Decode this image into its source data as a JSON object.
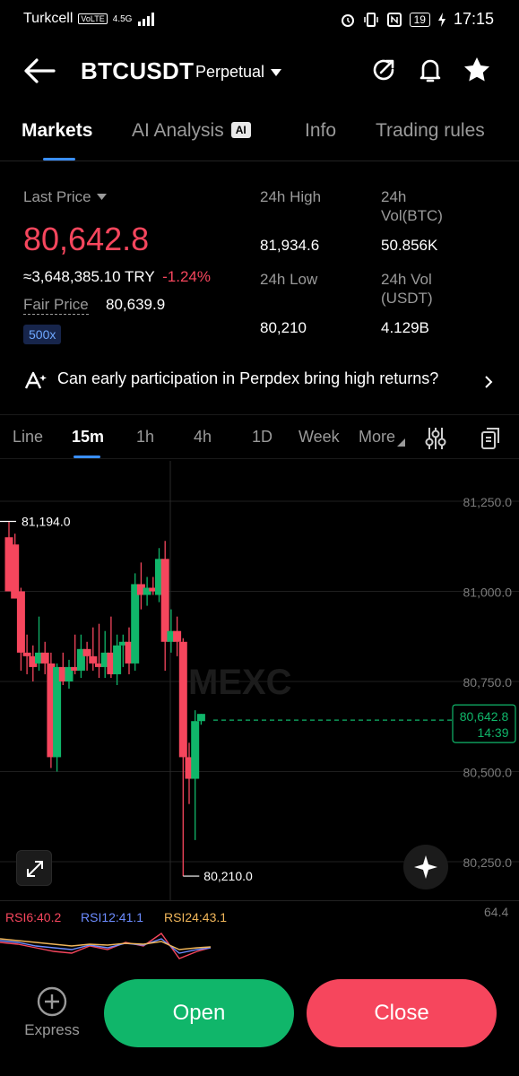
{
  "status_bar": {
    "carrier": "Turkcell",
    "volte": "VoLTE",
    "signal": "4.5G",
    "battery": "19",
    "time": "17:15"
  },
  "header": {
    "symbol": "BTCUSDT",
    "contract": "Perpetual"
  },
  "tabs": [
    {
      "label": "Markets",
      "active": true
    },
    {
      "label": "AI Analysis",
      "badge": "AI"
    },
    {
      "label": "Info"
    },
    {
      "label": "Trading rules"
    }
  ],
  "stats": {
    "last_price_label": "Last Price",
    "last_price": "80,642.8",
    "try_value": "≈3,648,385.10 TRY",
    "change": "-1.24%",
    "fair_price_label": "Fair Price",
    "fair_price": "80,639.9",
    "leverage": "500x",
    "high_label": "24h High",
    "high": "81,934.6",
    "low_label": "24h Low",
    "low": "80,210",
    "vol_btc_label_1": "24h",
    "vol_btc_label_2": "Vol(BTC)",
    "vol_btc": "50.856K",
    "vol_usdt_label_1": "24h Vol",
    "vol_usdt_label_2": "(USDT)",
    "vol_usdt": "4.129B"
  },
  "banner": {
    "text": "Can early participation in Perpdex bring high returns?"
  },
  "intervals": [
    {
      "label": "Line"
    },
    {
      "label": "15m",
      "active": true
    },
    {
      "label": "1h"
    },
    {
      "label": "4h"
    },
    {
      "label": "1D"
    },
    {
      "label": "Week"
    },
    {
      "label": "More"
    }
  ],
  "chart": {
    "watermark": "MEXC",
    "price_labels": [
      "81,250.0",
      "81,000.0",
      "80,750.0",
      "80,500.0",
      "80,250.0"
    ],
    "high_marker": "81,194.0",
    "low_marker": "80,210.0",
    "current_price": "80,642.8",
    "countdown": "14:39",
    "colors": {
      "up": "#10b66a",
      "down": "#f6465d"
    }
  },
  "chart_data": {
    "type": "candlestick",
    "y_ticks": [
      81250,
      81000,
      80750,
      80500,
      80250
    ],
    "ylim": [
      80200,
      81250
    ],
    "candles": [
      {
        "o": 81150,
        "h": 81194,
        "l": 81000,
        "c": 81000
      },
      {
        "o": 81130,
        "h": 81160,
        "l": 80980,
        "c": 80980
      },
      {
        "o": 81000,
        "h": 81010,
        "l": 80780,
        "c": 80830
      },
      {
        "o": 80830,
        "h": 80880,
        "l": 80770,
        "c": 80820
      },
      {
        "o": 80820,
        "h": 80850,
        "l": 80750,
        "c": 80790
      },
      {
        "o": 80800,
        "h": 80930,
        "l": 80780,
        "c": 80830
      },
      {
        "o": 80830,
        "h": 80860,
        "l": 80770,
        "c": 80800
      },
      {
        "o": 80800,
        "h": 80830,
        "l": 80510,
        "c": 80540
      },
      {
        "o": 80540,
        "h": 80800,
        "l": 80500,
        "c": 80790
      },
      {
        "o": 80790,
        "h": 80830,
        "l": 80740,
        "c": 80750
      },
      {
        "o": 80750,
        "h": 80810,
        "l": 80730,
        "c": 80790
      },
      {
        "o": 80790,
        "h": 80880,
        "l": 80770,
        "c": 80780
      },
      {
        "o": 80780,
        "h": 80880,
        "l": 80760,
        "c": 80840
      },
      {
        "o": 80840,
        "h": 80860,
        "l": 80780,
        "c": 80820
      },
      {
        "o": 80820,
        "h": 80900,
        "l": 80780,
        "c": 80800
      },
      {
        "o": 80800,
        "h": 80910,
        "l": 80760,
        "c": 80790
      },
      {
        "o": 80790,
        "h": 80890,
        "l": 80760,
        "c": 80830
      },
      {
        "o": 80830,
        "h": 80930,
        "l": 80760,
        "c": 80770
      },
      {
        "o": 80770,
        "h": 80880,
        "l": 80740,
        "c": 80850
      },
      {
        "o": 80850,
        "h": 80880,
        "l": 80790,
        "c": 80860
      },
      {
        "o": 80860,
        "h": 80900,
        "l": 80770,
        "c": 80800
      },
      {
        "o": 80800,
        "h": 81050,
        "l": 80780,
        "c": 81020
      },
      {
        "o": 81020,
        "h": 81080,
        "l": 80950,
        "c": 80990
      },
      {
        "o": 80990,
        "h": 81040,
        "l": 80960,
        "c": 81010
      },
      {
        "o": 81010,
        "h": 81040,
        "l": 80990,
        "c": 81000
      },
      {
        "o": 80990,
        "h": 81120,
        "l": 80970,
        "c": 81090
      },
      {
        "o": 81090,
        "h": 81140,
        "l": 80780,
        "c": 80860
      },
      {
        "o": 80860,
        "h": 80950,
        "l": 80830,
        "c": 80890
      },
      {
        "o": 80890,
        "h": 80930,
        "l": 80820,
        "c": 80860
      },
      {
        "o": 80860,
        "h": 80870,
        "l": 80210,
        "c": 80540
      },
      {
        "o": 80540,
        "h": 80580,
        "l": 80410,
        "c": 80480
      },
      {
        "o": 80480,
        "h": 80670,
        "l": 80310,
        "c": 80640
      },
      {
        "o": 80640,
        "h": 80660,
        "l": 80630,
        "c": 80660
      }
    ]
  },
  "rsi": {
    "rsi6": "RSI6:40.2",
    "rsi12": "RSI12:41.1",
    "rsi24": "RSI24:43.1",
    "level": "64.4"
  },
  "bottom": {
    "express": "Express",
    "open": "Open",
    "close": "Close"
  }
}
